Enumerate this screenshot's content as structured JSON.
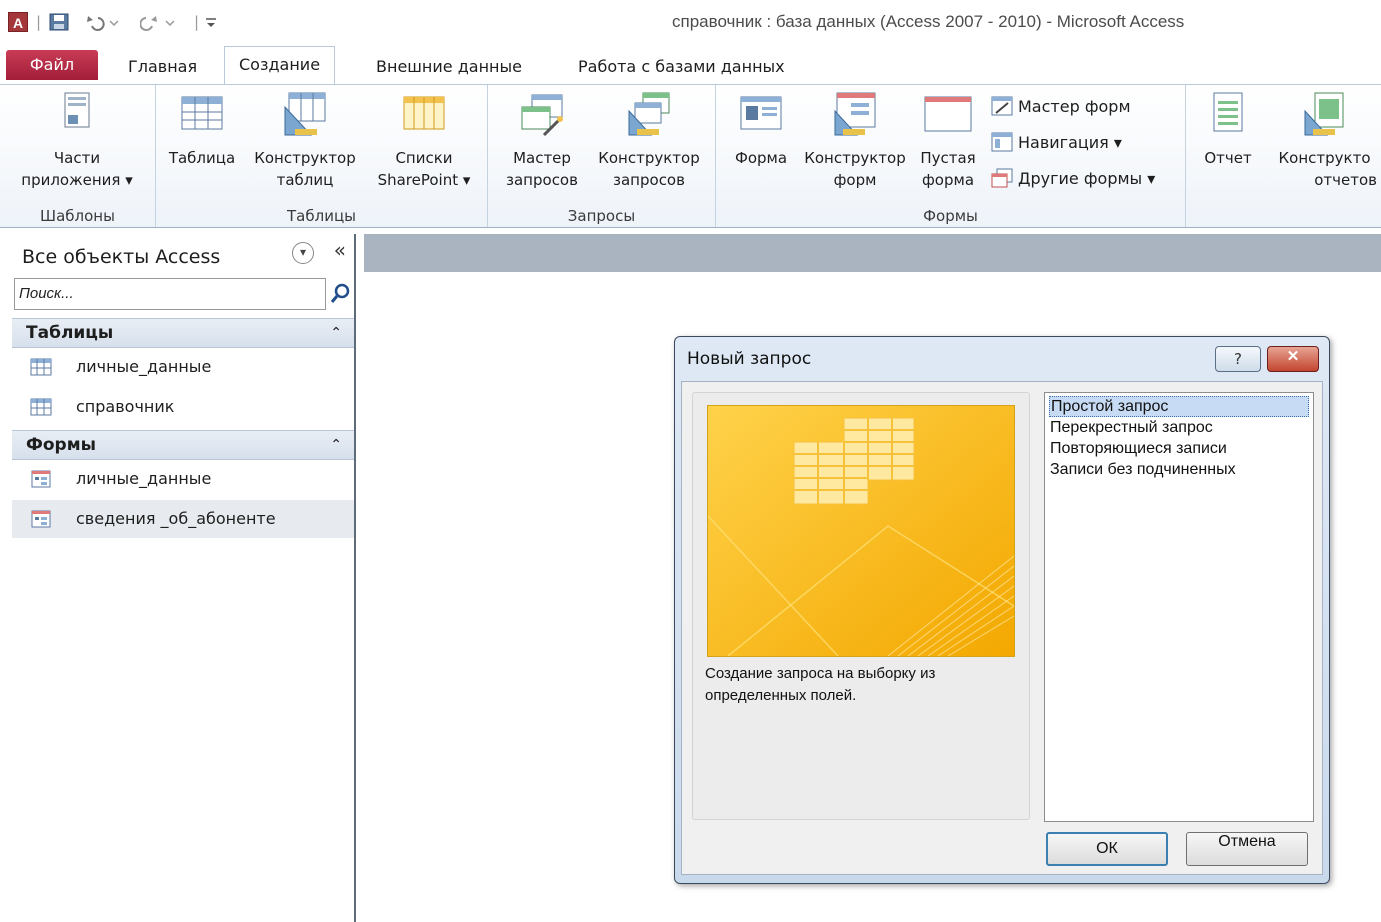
{
  "window": {
    "title": "справочник : база данных (Access 2007 - 2010)  -  Microsoft Access",
    "app_logo": "A"
  },
  "quick_access": {
    "icons": [
      "save-icon",
      "undo-icon",
      "redo-icon",
      "customize-icon"
    ]
  },
  "ribbon_tabs": [
    {
      "label": "Файл"
    },
    {
      "label": "Главная"
    },
    {
      "label": "Создание",
      "active": true
    },
    {
      "label": "Внешние данные"
    },
    {
      "label": "Работа с базами данных"
    }
  ],
  "ribbon": {
    "groups": {
      "templates": "Шаблоны",
      "tables": "Таблицы",
      "queries": "Запросы",
      "forms": "Формы"
    },
    "buttons": {
      "app_parts_1": "Части",
      "app_parts_2": "приложения ▾",
      "table": "Таблица",
      "table_designer_1": "Конструктор",
      "table_designer_2": "таблиц",
      "sharepoint_1": "Списки",
      "sharepoint_2": "SharePoint ▾",
      "query_wizard_1": "Мастер",
      "query_wizard_2": "запросов",
      "query_designer_1": "Конструктор",
      "query_designer_2": "запросов",
      "form": "Форма",
      "form_designer_1": "Конструктор",
      "form_designer_2": "форм",
      "blank_form_1": "Пустая",
      "blank_form_2": "форма",
      "form_wizard": "Мастер форм",
      "navigation": "Навигация ▾",
      "other_forms": "Другие формы ▾",
      "report": "Отчет",
      "report_designer_1": "Конструкто",
      "report_designer_2": "отчетов"
    }
  },
  "nav_pane": {
    "header": "Все объекты Access",
    "collapse": "«",
    "search_placeholder": "Поиск...",
    "sections": [
      {
        "label": "Таблицы",
        "items": [
          "личные_данные",
          "справочник"
        ]
      },
      {
        "label": "Формы",
        "items": [
          "личные_данные",
          "сведения _об_абоненте"
        ]
      }
    ]
  },
  "dialog": {
    "title": "Новый запрос",
    "help_label": "?",
    "close_label": "✕",
    "description": "Создание запроса на выборку из определенных полей.",
    "options": [
      "Простой запрос",
      "Перекрестный запрос",
      "Повторяющиеся записи",
      "Записи без подчиненных"
    ],
    "selected_index": 0,
    "ok_label": "ОК",
    "cancel_label": "Отмена"
  },
  "colors": {
    "file_tab": "#b42b47",
    "ribbon_bg": "#eef3f9",
    "workspace_strip": "#aab4c1",
    "preview_orange": "#f7b500",
    "selection": "#c7dcf4"
  }
}
